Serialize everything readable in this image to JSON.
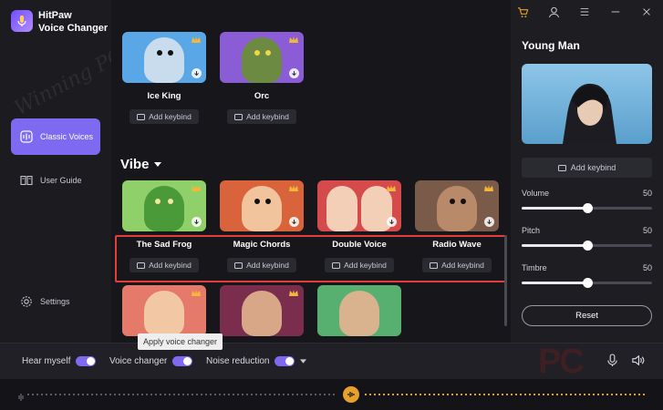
{
  "app": {
    "name_line1": "HitPaw",
    "name_line2": "Voice Changer"
  },
  "watermark": "Winning PC",
  "sidebar": {
    "items": [
      {
        "label": "Classic Voices",
        "icon": "voice-wave-icon",
        "active": true
      },
      {
        "label": "User Guide",
        "icon": "book-icon",
        "active": false
      },
      {
        "label": "Settings",
        "icon": "gear-icon",
        "active": false
      }
    ]
  },
  "main": {
    "top_cards": [
      {
        "name": "Ice King",
        "keybind": "Add keybind",
        "color": "#5aa7e8"
      },
      {
        "name": "Orc",
        "keybind": "Add keybind",
        "color": "#8a5dd6"
      }
    ],
    "section_title": "Vibe",
    "vibe_cards": [
      {
        "name": "The Sad Frog",
        "keybind": "Add keybind",
        "color": "#8fd06a"
      },
      {
        "name": "Magic Chords",
        "keybind": "Add keybind",
        "color": "#d9643c"
      },
      {
        "name": "Double Voice",
        "keybind": "Add keybind",
        "color": "#d54a4a"
      },
      {
        "name": "Radio Wave",
        "keybind": "Add keybind",
        "color": "#7a5a48"
      }
    ],
    "bottom_cards": [
      {
        "color": "#e57a6a"
      },
      {
        "color": "#7b2d4e"
      },
      {
        "color": "#58b070"
      }
    ]
  },
  "right_panel": {
    "title": "Young Man",
    "keybind": "Add keybind",
    "sliders": [
      {
        "label": "Volume",
        "value": 50
      },
      {
        "label": "Pitch",
        "value": 50
      },
      {
        "label": "Timbre",
        "value": 50
      }
    ],
    "reset_label": "Reset"
  },
  "bottom_bar": {
    "hear_myself": "Hear myself",
    "voice_changer": "Voice changer",
    "noise_reduction": "Noise reduction",
    "tooltip": "Apply voice changer"
  },
  "brand_watermark": "PC",
  "colors": {
    "accent": "#7d6af0",
    "highlight": "#e53c3c",
    "wave": "#d9a23a"
  }
}
